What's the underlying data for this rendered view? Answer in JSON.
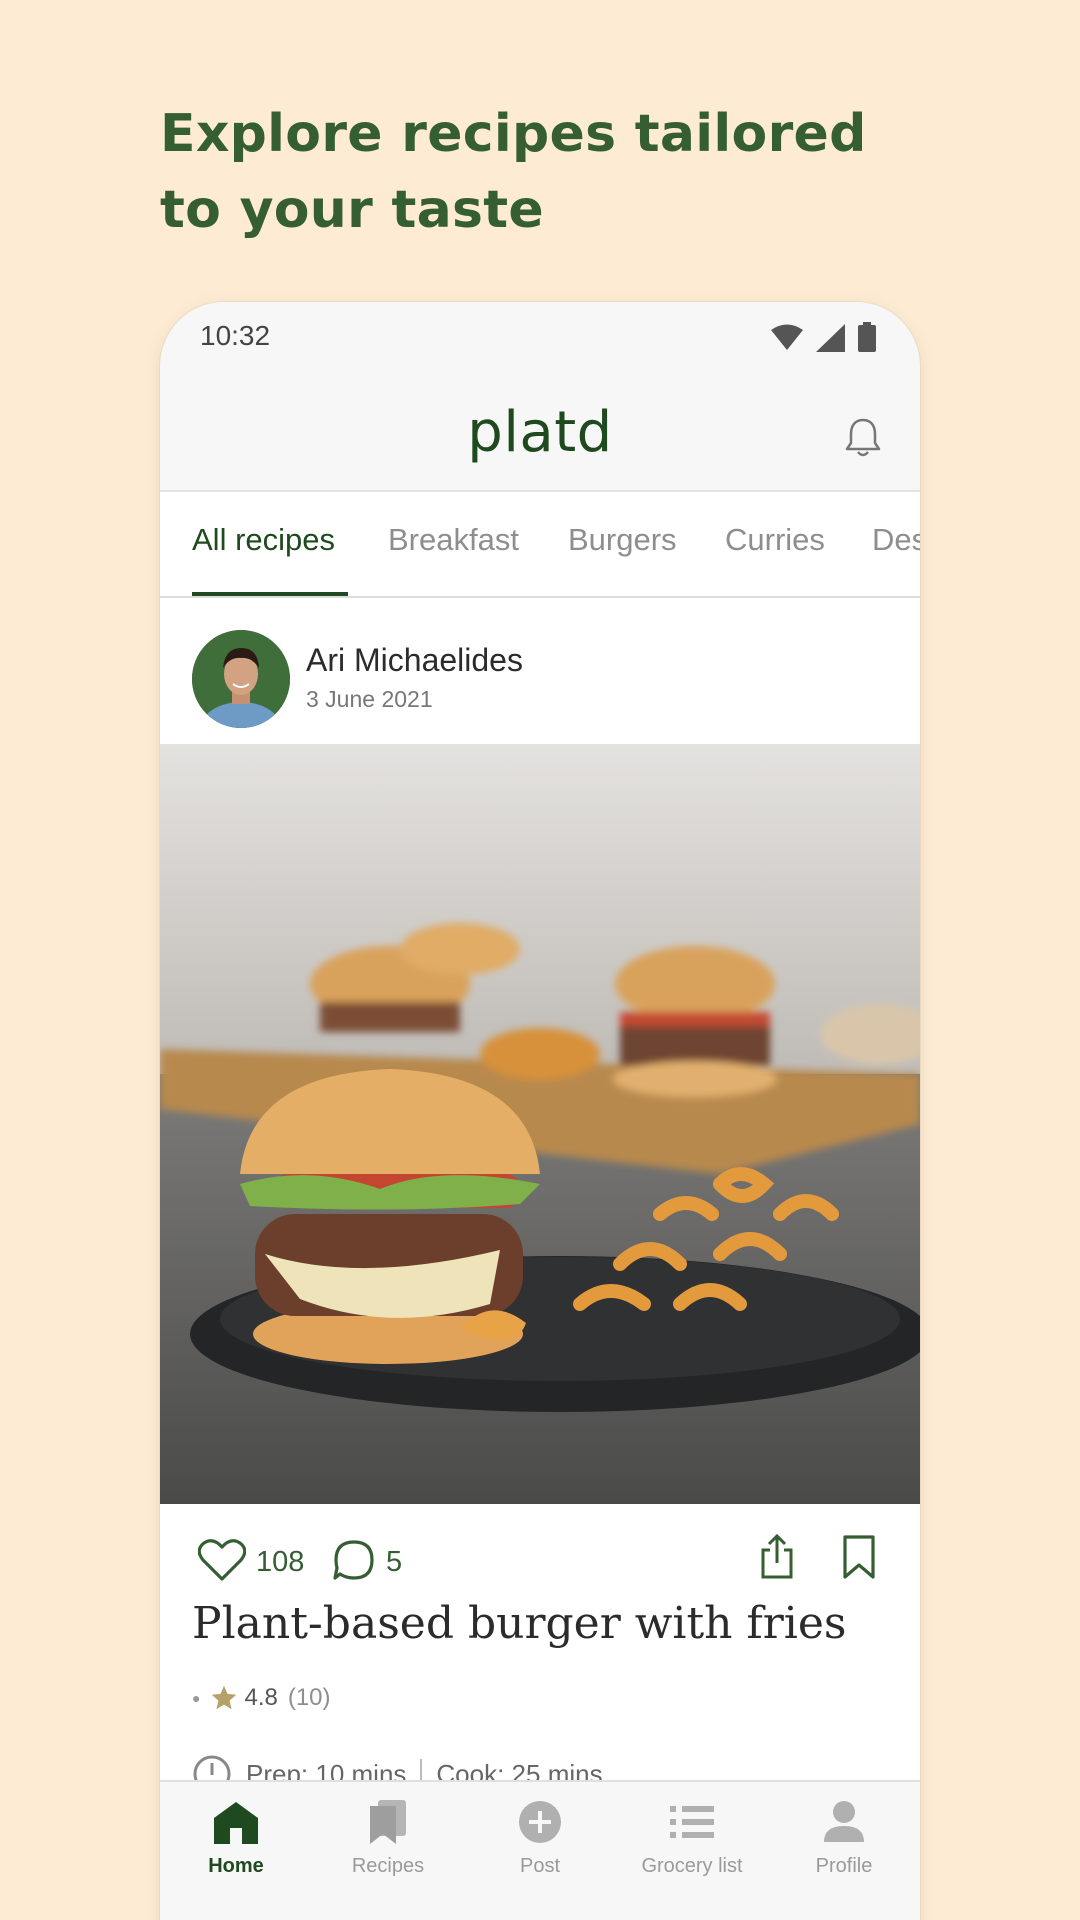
{
  "headline": "Explore recipes tailored to your taste",
  "status_bar": {
    "time": "10:32"
  },
  "app_bar": {
    "logo_text": "platd"
  },
  "tabs": [
    {
      "label": "All recipes",
      "active": true
    },
    {
      "label": "Breakfast"
    },
    {
      "label": "Burgers"
    },
    {
      "label": "Curries"
    },
    {
      "label": "Des"
    }
  ],
  "post": {
    "author": "Ari Michaelides",
    "date": "3 June 2021",
    "likes": "108",
    "comments": "5",
    "title": "Plant-based burger with fries",
    "rating": "4.8",
    "rating_count": "(10)",
    "prep": "Prep: 10 mins",
    "cook": "Cook: 25 mins"
  },
  "bottom_nav": [
    {
      "label": "Home",
      "icon": "home-icon",
      "active": true
    },
    {
      "label": "Recipes",
      "icon": "recipes-icon"
    },
    {
      "label": "Post",
      "icon": "plus-circle-icon"
    },
    {
      "label": "Grocery list",
      "icon": "list-icon"
    },
    {
      "label": "Profile",
      "icon": "person-icon"
    }
  ],
  "colors": {
    "brand": "#1f4a1f",
    "headline": "#355e32",
    "background": "#fdebd3",
    "star": "#b8a06a"
  }
}
